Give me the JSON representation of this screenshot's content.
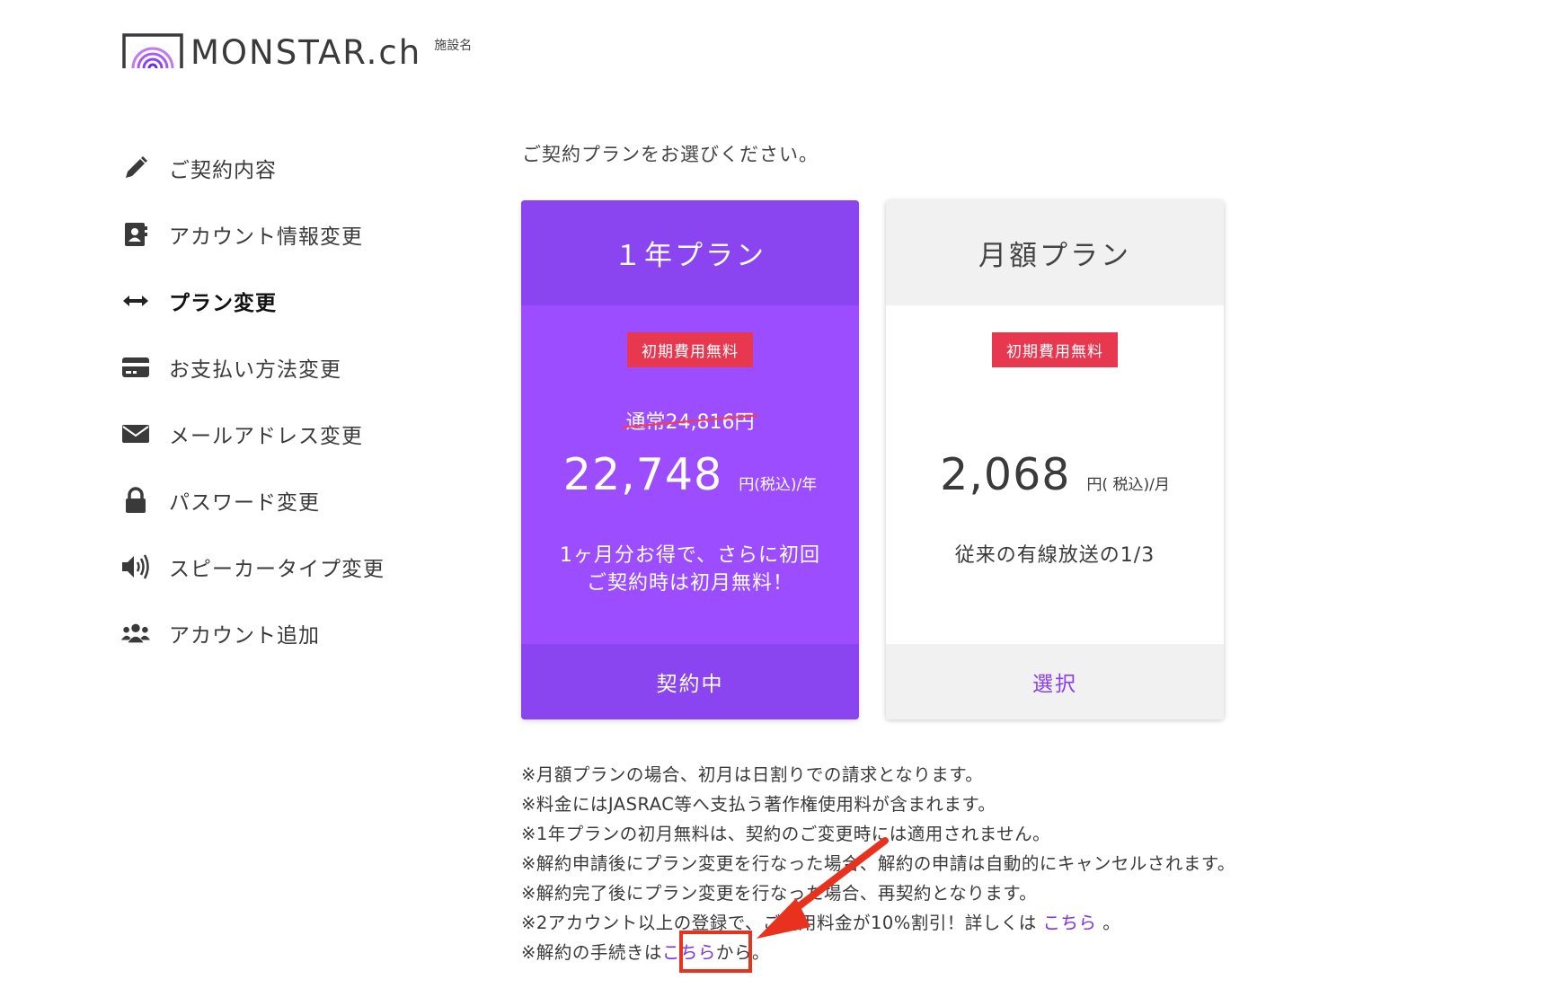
{
  "brand": {
    "logo_text": "MONSTAR.ch",
    "facility_label": "施設名",
    "accent_color": "#9b4dff"
  },
  "sidebar": {
    "items": [
      {
        "label": "ご契約内容",
        "icon": "pencil-icon",
        "active": false
      },
      {
        "label": "アカウント情報変更",
        "icon": "contact-card-icon",
        "active": false
      },
      {
        "label": "プラン変更",
        "icon": "double-arrow-icon",
        "active": true
      },
      {
        "label": "お支払い方法変更",
        "icon": "credit-card-icon",
        "active": false
      },
      {
        "label": "メールアドレス変更",
        "icon": "envelope-icon",
        "active": false
      },
      {
        "label": "パスワード変更",
        "icon": "lock-icon",
        "active": false
      },
      {
        "label": "スピーカータイプ変更",
        "icon": "speaker-icon",
        "active": false
      },
      {
        "label": "アカウント追加",
        "icon": "users-icon",
        "active": false
      }
    ]
  },
  "main": {
    "intro": "ご契約プランをお選びください。",
    "plans": [
      {
        "name": "１年プラン",
        "badge": "初期費用無料",
        "old_price": "通常24,816円",
        "price": "22,748",
        "unit": "円(税込)/年",
        "desc_line1": "1ヶ月分お得で、さらに初回",
        "desc_line2": "ご契約時は初月無料！",
        "action": "契約中"
      },
      {
        "name": "月額プラン",
        "badge": "初期費用無料",
        "price": "2,068",
        "unit": "円( 税込)/月",
        "desc_line1": "従来の有線放送の1/3",
        "action": "選択"
      }
    ],
    "notes": {
      "n1": "※月額プランの場合、初月は日割りでの請求となります。",
      "n2": "※料金にはJASRAC等へ支払う著作権使用料が含まれます。",
      "n3": "※1年プランの初月無料は、契約のご変更時には適用されません。",
      "n4": "※解約申請後にプラン変更を行なった場合、解約の申請は自動的にキャンセルされます。",
      "n5": "※解約完了後にプラン変更を行なった場合、再契約となります。",
      "n6_pre": "※2アカウント以上の登録で、ご利用料金が10%割引！詳しくは ",
      "n6_link": "こちら",
      "n6_post": " 。",
      "n7_pre": "※解約の手続きは",
      "n7_link": "こちら",
      "n7_post": "から。"
    }
  },
  "colors": {
    "badge": "#e8384f",
    "annotation": "#e8321e",
    "link": "#7a34e8"
  }
}
